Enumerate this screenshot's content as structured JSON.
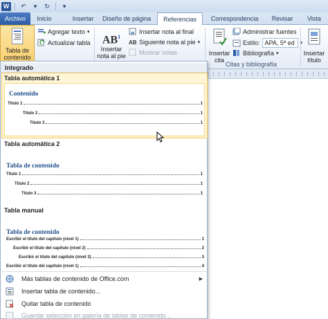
{
  "quick_access": {
    "app_logo": "W",
    "undo_glyph": "↶",
    "redo_glyph": "↻",
    "dropdown_glyph": "▾"
  },
  "tabs": [
    {
      "label": "Archivo",
      "active": false,
      "file": true
    },
    {
      "label": "Inicio",
      "active": false
    },
    {
      "label": "Insertar",
      "active": false
    },
    {
      "label": "Diseño de página",
      "active": false
    },
    {
      "label": "Referencias",
      "active": true
    },
    {
      "label": "Correspondencia",
      "active": false
    },
    {
      "label": "Revisar",
      "active": false
    },
    {
      "label": "Vista",
      "active": false
    }
  ],
  "ribbon": {
    "toc_button": {
      "line1": "Tabla de",
      "line2": "contenido",
      "arrow": "▾"
    },
    "add_text": "Agregar texto",
    "update_table": "Actualizar tabla",
    "insert_footnote": {
      "line1": "Insertar",
      "line2": "nota al pie"
    },
    "footnote_icon_text": "AB",
    "footnote_icon_sup": "1",
    "insert_endnote": "Insertar nota al final",
    "next_footnote": "Siguiente nota al pie",
    "show_notes": "Mostrar notas",
    "insert_citation": {
      "line1": "Insertar",
      "line2": "cita"
    },
    "manage_sources": "Administrar fuentes",
    "style_label": "Estilo:",
    "style_value": "APA, 5ª ed",
    "bibliography": "Bibliografía",
    "citations_group": "Citas y bibliografía",
    "insert_title": {
      "line1": "Insertar",
      "line2": "título"
    }
  },
  "gallery": {
    "section_builtin": "Integrado",
    "auto1": {
      "name": "Tabla automática 1",
      "heading": "Contenido",
      "lines": [
        {
          "text": "Título 1",
          "page": "1"
        },
        {
          "text": "Título 2",
          "page": "1"
        },
        {
          "text": "Título 3",
          "page": "1"
        }
      ]
    },
    "auto2": {
      "name": "Tabla automática 2",
      "heading": "Tabla de contenido",
      "lines": [
        {
          "text": "Título 1",
          "page": "1"
        },
        {
          "text": "Título 2",
          "page": "1"
        },
        {
          "text": "Título 3",
          "page": "1"
        }
      ]
    },
    "manual": {
      "name": "Tabla manual",
      "heading": "Tabla de contenido",
      "lines": [
        {
          "text": "Escribir el título del capítulo (nivel 1)",
          "page": "1"
        },
        {
          "text": "Escribir el título del capítulo (nivel 2)",
          "page": "2"
        },
        {
          "text": "Escribir el título del capítulo (nivel 3)",
          "page": "3"
        },
        {
          "text": "Escribir el título del capítulo (nivel 1)",
          "page": "4"
        }
      ]
    }
  },
  "menu": {
    "more_tables": "Más tablas de contenido de Office.com",
    "insert_table": "Insertar tabla de contenido...",
    "remove_table": "Quitar tabla de contenido",
    "save_selection": "Guardar selección en galería de tablas de contenido...",
    "submenu_arrow": "▶"
  },
  "colors": {
    "toc_heading": "#1f4e8a",
    "hover_fill": "#fff6d8",
    "hover_border": "#f2c95b",
    "file_tab": "#2b5ca6"
  }
}
